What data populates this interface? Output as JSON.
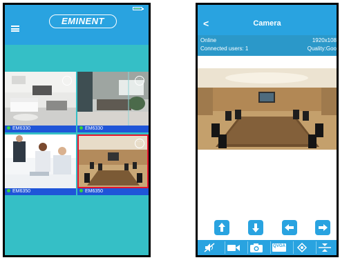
{
  "left_screen": {
    "logo_text": "EMINENT",
    "cameras": [
      {
        "name": "EM6330",
        "online": true
      },
      {
        "name": "EM6330",
        "online": true
      },
      {
        "name": "EM6350",
        "online": true
      },
      {
        "name": "EM6350",
        "online": true,
        "selected": true
      }
    ],
    "more_glyph": "···"
  },
  "right_screen": {
    "back_glyph": "<",
    "title": "Camera",
    "status": "Online",
    "resolution": "1920x108",
    "connected_users": "Connected users: 1",
    "quality": "Quality:Goo",
    "ptz_buttons": [
      "up-arrow-icon",
      "down-arrow-icon",
      "left-arrow-icon",
      "right-arrow-icon"
    ],
    "toolbar": [
      "mute-icon",
      "record-icon",
      "snapshot-icon",
      "qvga-icon",
      "preset-icon",
      "flip-icon"
    ],
    "toolbar_qvga_label": "QVGA"
  },
  "colors": {
    "header_blue": "#29a3e0",
    "screen_teal": "#35bfc6",
    "label_blue": "#1f55d8",
    "selected_red": "#e5142e",
    "online_green": "#39d33a"
  }
}
